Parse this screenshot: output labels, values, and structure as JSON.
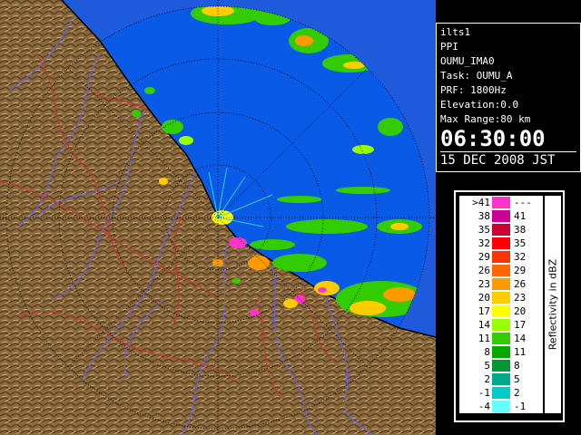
{
  "info": {
    "station": "ilts1",
    "mode": "PPI",
    "product": "OUMU_IMA0",
    "task": "Task: OUMU_A",
    "prf": "PRF: 1800Hz",
    "elevation": "Elevation:0.0",
    "max_range": "Max Range:80 km",
    "time": "06:30:00",
    "date": "15 DEC 2008 JST"
  },
  "legend": {
    "title": "Reflectivity in dBZ",
    "rows": [
      {
        "lo": ">41",
        "hi": "---",
        "color": "#ff33cc"
      },
      {
        "lo": "38",
        "hi": "41",
        "color": "#cc0099"
      },
      {
        "lo": "35",
        "hi": "38",
        "color": "#cc0033"
      },
      {
        "lo": "32",
        "hi": "35",
        "color": "#ff0000"
      },
      {
        "lo": "29",
        "hi": "32",
        "color": "#ff3300"
      },
      {
        "lo": "26",
        "hi": "29",
        "color": "#ff6600"
      },
      {
        "lo": "23",
        "hi": "26",
        "color": "#ff9900"
      },
      {
        "lo": "20",
        "hi": "23",
        "color": "#ffcc00"
      },
      {
        "lo": "17",
        "hi": "20",
        "color": "#ffff00"
      },
      {
        "lo": "14",
        "hi": "17",
        "color": "#99ff00"
      },
      {
        "lo": "11",
        "hi": "14",
        "color": "#33cc00"
      },
      {
        "lo": "8",
        "hi": "11",
        "color": "#00aa00"
      },
      {
        "lo": "5",
        "hi": "8",
        "color": "#009933"
      },
      {
        "lo": "2",
        "hi": "5",
        "color": "#00aa88"
      },
      {
        "lo": "-1",
        "hi": "2",
        "color": "#00cccc"
      },
      {
        "lo": "-4",
        "hi": "-1",
        "color": "#66ffff"
      }
    ]
  },
  "colors": {
    "sea": "#0a5ae8",
    "outer_sea": "#1e5adc",
    "land": "#8a6a3c",
    "rivers": "#6060ff",
    "roads": "#cc3030",
    "range_rings": "#000000"
  }
}
